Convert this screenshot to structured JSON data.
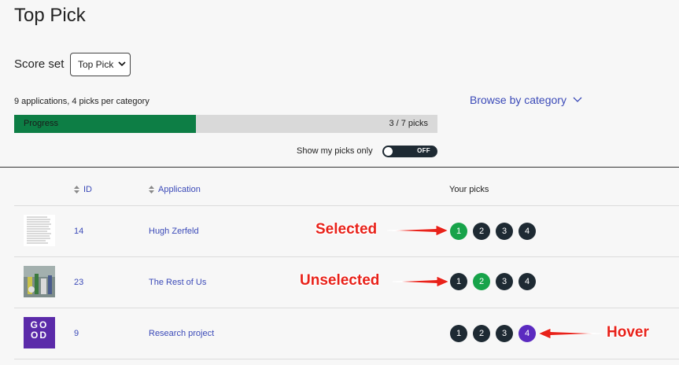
{
  "header": {
    "title": "Top Pick"
  },
  "score_set": {
    "label": "Score set",
    "selected": "Top Pick"
  },
  "summary": {
    "text": "9 applications, 4 picks per category"
  },
  "browse": {
    "label": "Browse by category"
  },
  "progress": {
    "label": "Progress",
    "count_text": "3 / 7 picks",
    "value": 0.43,
    "fill_color": "#0d7e45"
  },
  "my_picks_toggle": {
    "label": "Show my picks only",
    "state": "OFF"
  },
  "table": {
    "columns": {
      "id": "ID",
      "application": "Application",
      "your_picks": "Your picks"
    },
    "rows": [
      {
        "id": "14",
        "application": "Hugh Zerfeld",
        "picks": [
          "1",
          "2",
          "3",
          "4"
        ],
        "state": "pick-1-selected"
      },
      {
        "id": "23",
        "application": "The Rest of Us",
        "picks": [
          "1",
          "2",
          "3",
          "4"
        ],
        "state": "pick-2-selected"
      },
      {
        "id": "9",
        "application": "Research project",
        "thumbnail_text": "GO OD",
        "picks": [
          "1",
          "2",
          "3",
          "4"
        ],
        "state": "pick-4-hover"
      }
    ]
  },
  "annotations": {
    "selected": "Selected",
    "unselected": "Unselected",
    "hover": "Hover"
  },
  "colors": {
    "selected": "#17a34a",
    "default": "#1e2a33",
    "hover": "#5b2ac0",
    "link": "#3b4ab8",
    "callout": "#e8221a"
  }
}
